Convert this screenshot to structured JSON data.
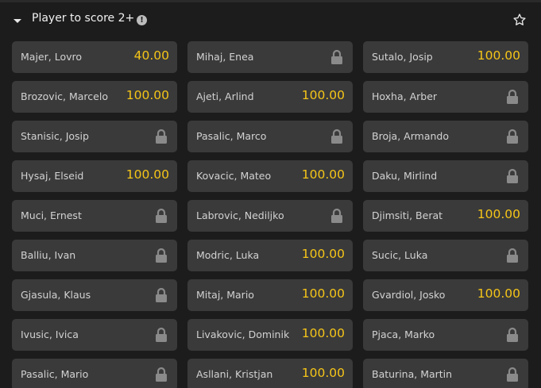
{
  "header": {
    "title": "Player to score 2+",
    "info_symbol": "!"
  },
  "colors": {
    "background": "#1c1c1c",
    "cell_background": "#3a3a3a",
    "odds": "#f5c518",
    "name": "#d2d2d2",
    "lock": "#8a8a8a"
  },
  "icons": {
    "collapse": "caret-down-icon",
    "info": "info-icon",
    "favorite": "star-outline-icon",
    "locked": "lock-icon"
  },
  "players": [
    {
      "name": "Majer, Lovro",
      "odds": "40.00"
    },
    {
      "name": "Mihaj, Enea",
      "odds": null
    },
    {
      "name": "Sutalo, Josip",
      "odds": "100.00"
    },
    {
      "name": "Brozovic, Marcelo",
      "odds": "100.00"
    },
    {
      "name": "Ajeti, Arlind",
      "odds": "100.00"
    },
    {
      "name": "Hoxha, Arber",
      "odds": null
    },
    {
      "name": "Stanisic, Josip",
      "odds": null
    },
    {
      "name": "Pasalic, Marco",
      "odds": null
    },
    {
      "name": "Broja, Armando",
      "odds": null
    },
    {
      "name": "Hysaj, Elseid",
      "odds": "100.00"
    },
    {
      "name": "Kovacic, Mateo",
      "odds": "100.00"
    },
    {
      "name": "Daku, Mirlind",
      "odds": null
    },
    {
      "name": "Muci, Ernest",
      "odds": null
    },
    {
      "name": "Labrovic, Nediljko",
      "odds": null
    },
    {
      "name": "Djimsiti, Berat",
      "odds": "100.00"
    },
    {
      "name": "Balliu, Ivan",
      "odds": null
    },
    {
      "name": "Modric, Luka",
      "odds": "100.00"
    },
    {
      "name": "Sucic, Luka",
      "odds": null
    },
    {
      "name": "Gjasula, Klaus",
      "odds": null
    },
    {
      "name": "Mitaj, Mario",
      "odds": "100.00"
    },
    {
      "name": "Gvardiol, Josko",
      "odds": "100.00"
    },
    {
      "name": "Ivusic, Ivica",
      "odds": null
    },
    {
      "name": "Livakovic, Dominik",
      "odds": "100.00"
    },
    {
      "name": "Pjaca, Marko",
      "odds": null
    },
    {
      "name": "Pasalic, Mario",
      "odds": null
    },
    {
      "name": "Asllani, Kristjan",
      "odds": "100.00"
    },
    {
      "name": "Baturina, Martin",
      "odds": null
    }
  ]
}
